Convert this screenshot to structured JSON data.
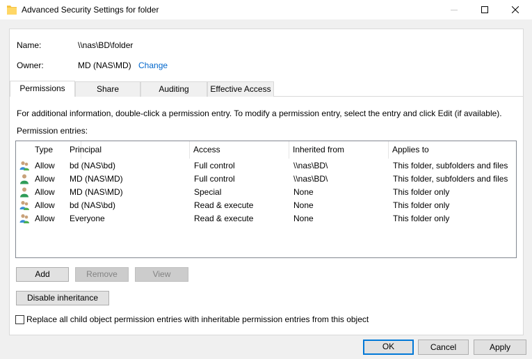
{
  "window": {
    "title": "Advanced Security Settings for folder"
  },
  "info": {
    "name_label": "Name:",
    "name_value": "\\\\nas\\BD\\folder",
    "owner_label": "Owner:",
    "owner_value": "MD (NAS\\MD)",
    "owner_change_link": "Change"
  },
  "tabs": [
    {
      "label": "Permissions",
      "active": true
    },
    {
      "label": "Share",
      "active": false
    },
    {
      "label": "Auditing",
      "active": false
    },
    {
      "label": "Effective Access",
      "active": false
    }
  ],
  "permissions": {
    "info_text": "For additional information, double-click a permission entry. To modify a permission entry, select the entry and click Edit (if available).",
    "entries_label": "Permission entries:",
    "columns": [
      "Type",
      "Principal",
      "Access",
      "Inherited from",
      "Applies to"
    ],
    "rows": [
      {
        "icon": "group-users-icon",
        "type": "Allow",
        "principal": "bd (NAS\\bd)",
        "access": "Full control",
        "inherited_from": "\\\\nas\\BD\\",
        "applies_to": "This folder, subfolders and files"
      },
      {
        "icon": "user-icon",
        "type": "Allow",
        "principal": "MD (NAS\\MD)",
        "access": "Full control",
        "inherited_from": "\\\\nas\\BD\\",
        "applies_to": "This folder, subfolders and files"
      },
      {
        "icon": "user-icon",
        "type": "Allow",
        "principal": "MD (NAS\\MD)",
        "access": "Special",
        "inherited_from": "None",
        "applies_to": "This folder only"
      },
      {
        "icon": "group-users-icon",
        "type": "Allow",
        "principal": "bd (NAS\\bd)",
        "access": "Read & execute",
        "inherited_from": "None",
        "applies_to": "This folder only"
      },
      {
        "icon": "group-users-icon",
        "type": "Allow",
        "principal": "Everyone",
        "access": "Read & execute",
        "inherited_from": "None",
        "applies_to": "This folder only"
      }
    ]
  },
  "buttons": {
    "add": "Add",
    "remove": "Remove",
    "view": "View",
    "disable_inheritance": "Disable inheritance",
    "ok": "OK",
    "cancel": "Cancel",
    "apply": "Apply"
  },
  "replace_checkbox": {
    "label": "Replace all child object permission entries with inheritable permission entries from this object",
    "checked": false
  },
  "colors": {
    "link": "#0066cc",
    "default_button_border": "#0078d7"
  }
}
